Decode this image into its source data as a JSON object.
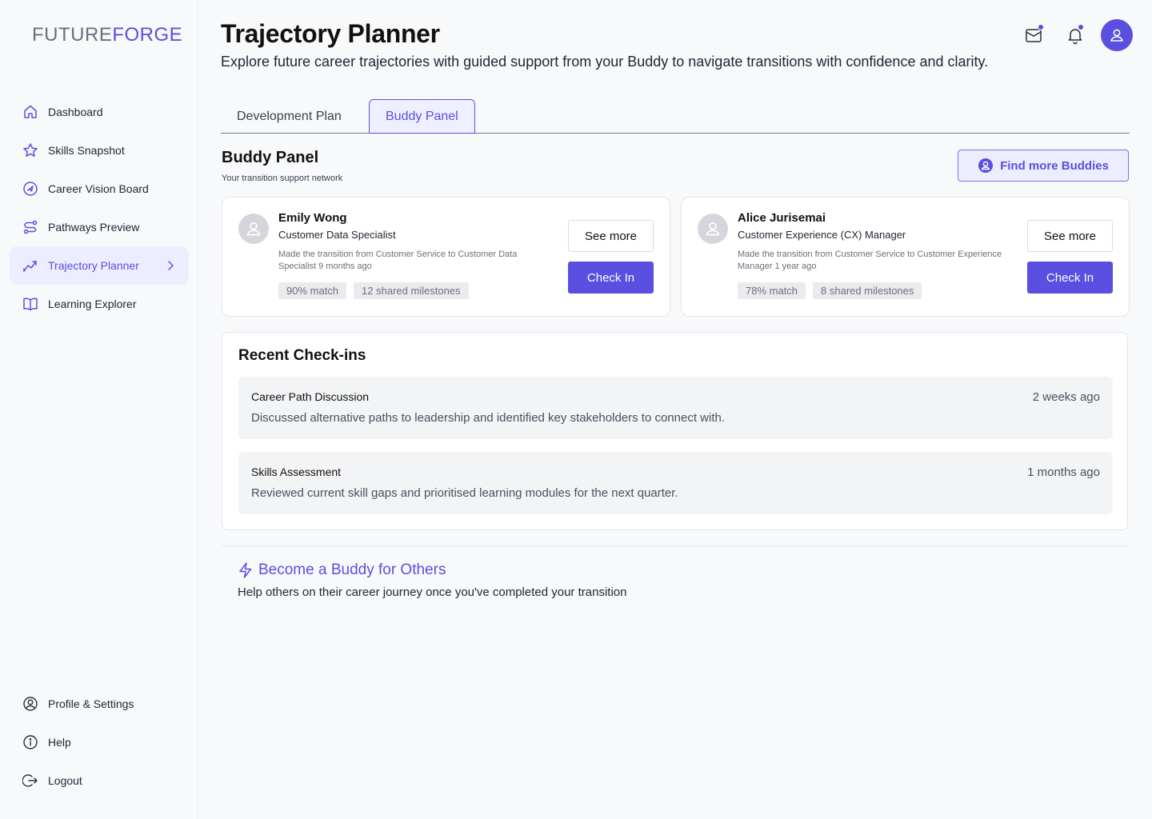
{
  "brand": {
    "part1": "FUTURE",
    "part2": "FORGE"
  },
  "sidebar": {
    "items": [
      {
        "label": "Dashboard",
        "icon": "home-icon"
      },
      {
        "label": "Skills Snapshot",
        "icon": "star-icon"
      },
      {
        "label": "Career Vision Board",
        "icon": "target-icon"
      },
      {
        "label": "Pathways Preview",
        "icon": "route-icon"
      },
      {
        "label": "Trajectory Planner",
        "icon": "trend-icon",
        "active": true
      },
      {
        "label": "Learning Explorer",
        "icon": "book-icon"
      }
    ],
    "bottom": [
      {
        "label": "Profile & Settings",
        "icon": "user-circle-icon"
      },
      {
        "label": "Help",
        "icon": "info-icon"
      },
      {
        "label": "Logout",
        "icon": "logout-icon"
      }
    ]
  },
  "header": {
    "title": "Trajectory Planner",
    "subtitle": "Explore future career trajectories with guided support from your Buddy to navigate transitions with confidence and clarity."
  },
  "tabs": [
    {
      "label": "Development Plan"
    },
    {
      "label": "Buddy Panel",
      "active": true
    }
  ],
  "panel": {
    "title": "Buddy Panel",
    "subtitle": "Your transition support network",
    "find_button": "Find more Buddies"
  },
  "buddies": [
    {
      "name": "Emily Wong",
      "role": "Customer Data Specialist",
      "description": "Made the transition from Customer Service to Customer Data Specialist 9 months ago",
      "match": "90% match",
      "milestones": "12 shared milestones",
      "see_more": "See more",
      "check_in": "Check In"
    },
    {
      "name": "Alice Jurisemai",
      "role": "Customer Experience (CX) Manager",
      "description": "Made the transition from Customer Service to Customer Experience Manager 1 year ago",
      "match": "78% match",
      "milestones": "8 shared milestones",
      "see_more": "See more",
      "check_in": "Check In"
    }
  ],
  "recent": {
    "title": "Recent Check-ins",
    "items": [
      {
        "title": "Career Path Discussion",
        "description": "Discussed alternative paths to leadership and identified key stakeholders to connect with.",
        "time": "2 weeks ago"
      },
      {
        "title": "Skills Assessment",
        "description": "Reviewed current skill gaps and prioritised learning modules for the next quarter.",
        "time": "1 months ago"
      }
    ]
  },
  "become": {
    "title": "Become a Buddy for Others",
    "subtitle": "Help others on their career journey once you've completed your transition"
  },
  "colors": {
    "accent": "#5a4fe0",
    "background": "#f8f9fb"
  }
}
